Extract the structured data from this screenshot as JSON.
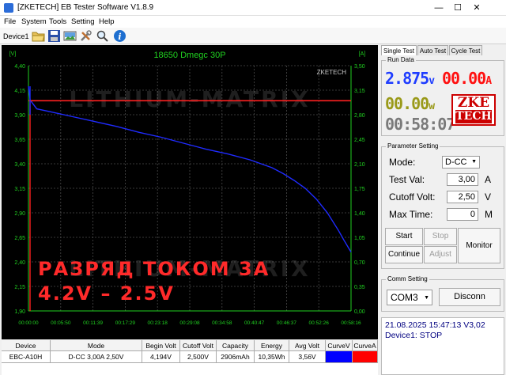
{
  "window": {
    "title": "[ZKETECH] EB Tester Software V1.8.9",
    "minimize": "—",
    "maximize": "☐",
    "close": "✕"
  },
  "menu": [
    "File",
    "System",
    "Tools",
    "Setting",
    "Help"
  ],
  "toolbar": {
    "device_label": "Device1",
    "icons": [
      "folder-open-icon",
      "save-icon",
      "image-icon",
      "tools-icon",
      "search-icon",
      "info-icon"
    ]
  },
  "chart_data": {
    "type": "line",
    "title": "18650 Dmegc 30P",
    "ylabel_left": "[V]",
    "ylabel_right": "[A]",
    "ylim_left": [
      1.9,
      4.4
    ],
    "ylim_right": [
      0.0,
      3.5
    ],
    "yticks_left": [
      "4,40",
      "4,15",
      "3,90",
      "3,65",
      "3,40",
      "3,15",
      "2,90",
      "2,65",
      "2,40",
      "2,15",
      "1,90"
    ],
    "yticks_right": [
      "3,50",
      "3,15",
      "2,80",
      "2,45",
      "2,10",
      "1,75",
      "1,40",
      "1,05",
      "0,70",
      "0,35",
      "0,00"
    ],
    "xticks": [
      "00:00:00",
      "00:05:50",
      "00:11:39",
      "00:17:29",
      "00:23:18",
      "00:29:08",
      "00:34:58",
      "00:40:47",
      "00:46:37",
      "00:52:26",
      "00:58:16"
    ],
    "grid": true,
    "watermark_corner": "ZKETECH",
    "watermark": "LITHIUM-MATRIX",
    "overlay_text": [
      "РАЗРЯД ТОКОМ 3А",
      "4.2V – 2.5V"
    ],
    "series": [
      {
        "axis": "left",
        "color": "#1f2bff",
        "x_min": [
          0,
          0.3,
          1.5,
          4,
          8,
          12,
          16,
          20,
          24,
          28,
          32,
          36,
          40,
          44,
          46,
          48,
          50,
          52,
          54,
          56,
          57,
          58.27
        ],
        "values": [
          4.19,
          4.05,
          3.96,
          3.93,
          3.88,
          3.83,
          3.78,
          3.72,
          3.67,
          3.61,
          3.55,
          3.5,
          3.44,
          3.36,
          3.3,
          3.23,
          3.15,
          3.04,
          2.9,
          2.72,
          2.62,
          2.5
        ]
      },
      {
        "axis": "right",
        "color": "#ff2020",
        "x_min": [
          0,
          58.27
        ],
        "values": [
          3.0,
          3.0
        ]
      }
    ]
  },
  "tabs": [
    "Single Test",
    "Auto Test",
    "Cycle Test"
  ],
  "run_data": {
    "title": "Run Data",
    "voltage": "2.875",
    "voltage_unit": "v",
    "current": "00.00",
    "current_unit": "A",
    "power": "00.00",
    "power_unit": "w",
    "time": "00:58:07",
    "logo_top": "ZKE",
    "logo_bottom": "TECH",
    "volt_color": "#1f3dff",
    "amp_color": "#ff1010"
  },
  "params": {
    "title": "Parameter Setting",
    "mode_label": "Mode:",
    "mode_value": "D-CC",
    "test_val_label": "Test Val:",
    "test_val": "3,00",
    "test_val_unit": "A",
    "cutoff_label": "Cutoff Volt:",
    "cutoff_value": "2,50",
    "cutoff_unit": "V",
    "max_time_label": "Max Time:",
    "max_time_value": "0",
    "max_time_unit": "M",
    "start": "Start",
    "stop": "Stop",
    "monitor": "Monitor",
    "continue": "Continue",
    "adjust": "Adjust"
  },
  "comm": {
    "title": "Comm Setting",
    "port": "COM3",
    "disconnect": "Disconn"
  },
  "status": {
    "line1": "21.08.2025 15:47:13  V3,02",
    "line2": "Device1: STOP"
  },
  "table": {
    "headers": [
      "Device",
      "Mode",
      "Begin Volt",
      "Cutoff Volt",
      "Capacity",
      "Energy",
      "Avg Volt",
      "CurveV",
      "CurveA"
    ],
    "row": [
      "EBC-A10H",
      "D-CC  3,00A  2,50V",
      "4,194V",
      "2,500V",
      "2906mAh",
      "10,35Wh",
      "3,56V",
      "",
      ""
    ],
    "curve_v_color": "#0000ff",
    "curve_a_color": "#ff0000"
  }
}
